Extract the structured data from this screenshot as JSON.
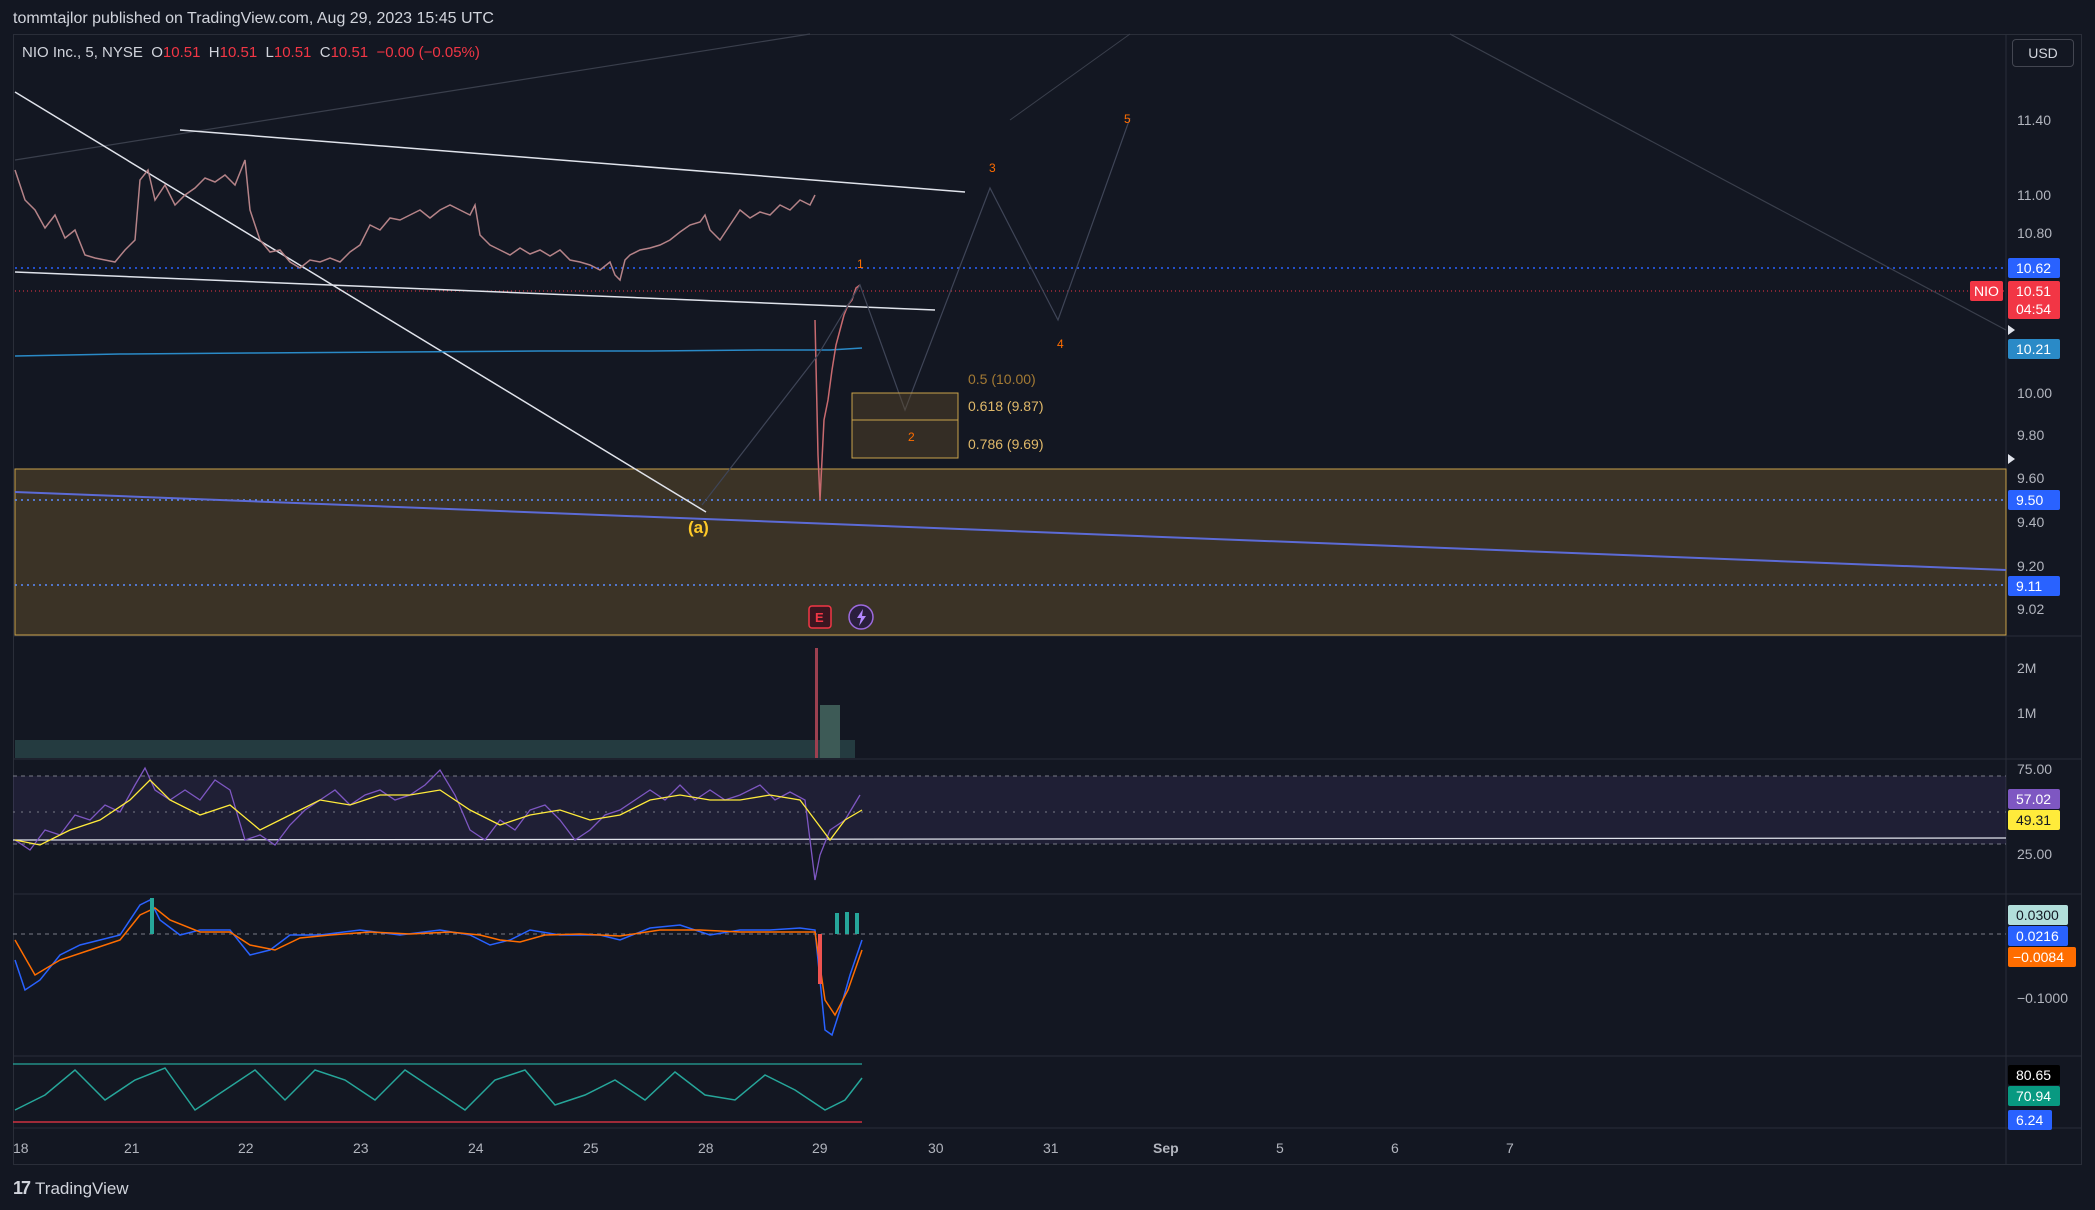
{
  "header": {
    "publisher_line": "tommtajlor published on TradingView.com, Aug 29, 2023 15:45 UTC"
  },
  "legend": {
    "symbol": "NIO Inc., 5, NYSE",
    "o_label": "O",
    "o_value": "10.51",
    "h_label": "H",
    "h_value": "10.51",
    "l_label": "L",
    "l_value": "10.51",
    "c_label": "C",
    "c_value": "10.51",
    "change": "−0.00 (−0.05%)"
  },
  "currency_button": "USD",
  "price_axis": {
    "ticks": [
      "11.40",
      "11.00",
      "10.80",
      "10.00",
      "9.80",
      "9.60",
      "9.40",
      "9.20",
      "9.02"
    ],
    "tags": {
      "line_1062": "10.62",
      "symbol_tag": "NIO",
      "last_price": "10.51",
      "countdown": "04:54",
      "ma_value": "10.21",
      "line_950": "9.50",
      "line_911": "9.11"
    }
  },
  "volume_axis": [
    "2M",
    "1M"
  ],
  "rsi_axis": {
    "ticks": [
      "75.00",
      "25.00"
    ],
    "rsi_value": "57.02",
    "rsi_ma_value": "49.31"
  },
  "macd_axis": {
    "hist": "0.0300",
    "macd": "0.0216",
    "signal": "−0.0084",
    "tick": "−0.1000"
  },
  "osc_axis": {
    "v1": "80.65",
    "v2": "70.94",
    "v3": "6.24"
  },
  "time_axis": [
    "18",
    "21",
    "22",
    "23",
    "24",
    "25",
    "28",
    "29",
    "30",
    "31",
    "Sep",
    "5",
    "6",
    "7"
  ],
  "annotations": {
    "wave_a": "(a)",
    "wave_1": "1",
    "wave_2": "2",
    "wave_3": "3",
    "wave_4": "4",
    "wave_5": "5",
    "fib_05": "0.5 (10.00)",
    "fib_0618": "0.618 (9.87)",
    "fib_0786": "0.786 (9.69)",
    "earnings_badge": "E"
  },
  "colors": {
    "background": "#131722",
    "up": "#26a69a",
    "down": "#ef5350",
    "price_red": "#f23645",
    "blue_tag": "#2962ff",
    "rsi": "#7e57c2",
    "rsi_ma": "#ffeb3b",
    "wave_orange": "#ff6d00"
  },
  "footer": {
    "brand": "TradingView",
    "logo_icon": "tradingview-logo-icon"
  }
}
